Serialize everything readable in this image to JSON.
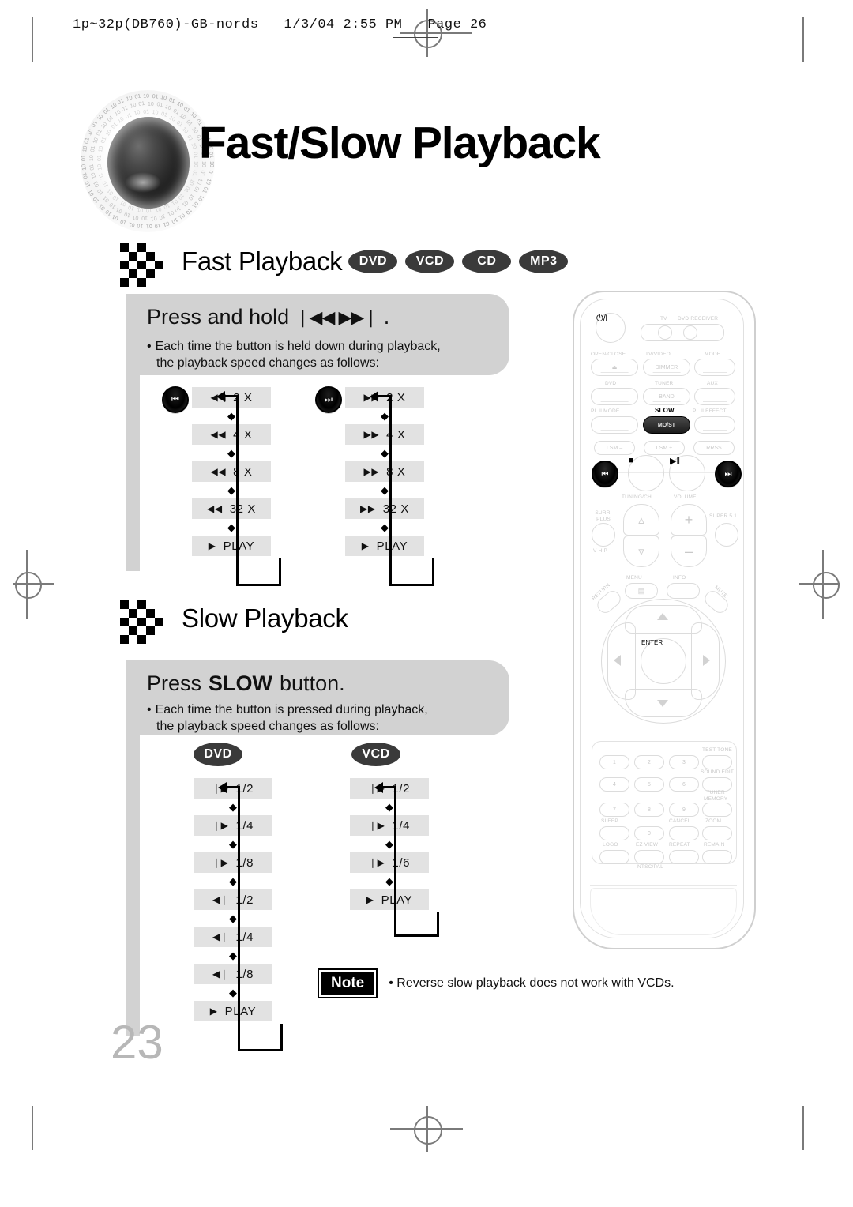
{
  "header": {
    "file_line": "1p~32p(DB760)-GB-nords   1/3/04 2:55 PM   Page 26"
  },
  "page": {
    "title": "Fast/Slow Playback",
    "number": "23"
  },
  "sections": [
    {
      "id": "fast",
      "heading": "Fast Playback",
      "badges": [
        "DVD",
        "VCD",
        "CD",
        "MP3"
      ],
      "callout": {
        "title_prefix": "Press and hold",
        "title_glyphs": "❘◀◀ ▶▶❘",
        "title_suffix": ".",
        "bullet": "•",
        "body_line1": "Each time the button is held down during playback,",
        "body_line2": "the playback speed changes as follows:"
      },
      "flows": [
        {
          "id": "fast-reverse",
          "start_icon": "skip-back",
          "steps": [
            {
              "glyph": "◀◀",
              "label": "2 X"
            },
            {
              "glyph": "◀◀",
              "label": "4 X"
            },
            {
              "glyph": "◀◀",
              "label": "8 X"
            },
            {
              "glyph": "◀◀",
              "label": "32 X"
            },
            {
              "glyph": "▶",
              "label": "PLAY"
            }
          ]
        },
        {
          "id": "fast-forward",
          "start_icon": "skip-forward",
          "steps": [
            {
              "glyph": "▶▶",
              "label": "2 X"
            },
            {
              "glyph": "▶▶",
              "label": "4 X"
            },
            {
              "glyph": "▶▶",
              "label": "8 X"
            },
            {
              "glyph": "▶▶",
              "label": "32 X"
            },
            {
              "glyph": "▶",
              "label": "PLAY"
            }
          ]
        }
      ]
    },
    {
      "id": "slow",
      "heading": "Slow Playback",
      "badges": [],
      "callout": {
        "title_prefix": "Press",
        "title_strong": "SLOW",
        "title_suffix": "button.",
        "bullet": "•",
        "body_line1": "Each time the button is pressed during playback,",
        "body_line2": "the playback speed changes as follows:"
      },
      "flows": [
        {
          "id": "slow-dvd",
          "badge": "DVD",
          "steps": [
            {
              "glyph": "❘▶",
              "label": "1/2"
            },
            {
              "glyph": "❘▶",
              "label": "1/4"
            },
            {
              "glyph": "❘▶",
              "label": "1/8"
            },
            {
              "glyph": "◀❘",
              "label": "1/2"
            },
            {
              "glyph": "◀❘",
              "label": "1/4"
            },
            {
              "glyph": "◀❘",
              "label": "1/8"
            },
            {
              "glyph": "▶",
              "label": "PLAY"
            }
          ]
        },
        {
          "id": "slow-vcd",
          "badge": "VCD",
          "steps": [
            {
              "glyph": "❘▶",
              "label": "1/2"
            },
            {
              "glyph": "❘▶",
              "label": "1/4"
            },
            {
              "glyph": "❘▶",
              "label": "1/6"
            },
            {
              "glyph": "▶",
              "label": "PLAY"
            }
          ]
        }
      ]
    }
  ],
  "note": {
    "tag": "Note",
    "bullet": "•",
    "text": "Reverse slow playback does not work with VCDs."
  },
  "remote": {
    "labels": {
      "power": "⏻/❘",
      "tv": "TV",
      "dvd_receiver": "DVD RECEIVER",
      "open_close": "OPEN/CLOSE",
      "eject": "⏏",
      "tv_video": "TV/VIDEO",
      "dimmer": "DIMMER",
      "mode": "MODE",
      "dvd": "DVD",
      "tuner": "TUNER",
      "band": "BAND",
      "aux": "AUX",
      "pl2_mode": "PL II MODE",
      "slow": "SLOW",
      "most": "MO/ST",
      "pl2_effect": "PL II EFFECT",
      "lsm_minus": "LSM –",
      "lsm_plus": "LSM +",
      "rrss": "RRSS",
      "skip_back": "⏮",
      "stop": "■",
      "play_pause": "▶‖",
      "skip_fwd": "⏭",
      "tuning_ch": "TUNING/CH",
      "volume": "VOLUME",
      "surr_plus": "SURR.\nPLUS",
      "v_hip": "V-HIP",
      "super51": "SUPER 5.1",
      "menu": "MENU",
      "info": "INFO",
      "return": "RETURN",
      "mute": "MUTE",
      "enter": "ENTER",
      "test_tone": "TEST TONE",
      "sound_edit": "SOUND EDIT",
      "tuner_memory": "TUNER\nMEMORY",
      "sleep": "SLEEP",
      "cancel": "CANCEL",
      "zoom": "ZOOM",
      "logo": "LOGO",
      "ez_view": "EZ VIEW",
      "repeat": "REPEAT",
      "remain": "REMAIN",
      "ntsc_pal": "NTSC/PAL"
    },
    "keypad": [
      "1",
      "2",
      "3",
      "4",
      "5",
      "6",
      "7",
      "8",
      "9",
      "0"
    ]
  },
  "colors": {
    "callout_bg": "#d2d2d2",
    "flowbox_bg": "#e2e2e2",
    "badge_bg": "#3a3a3a",
    "page_number": "#b7b7b7",
    "remote_outline": "#cfcfcf"
  }
}
